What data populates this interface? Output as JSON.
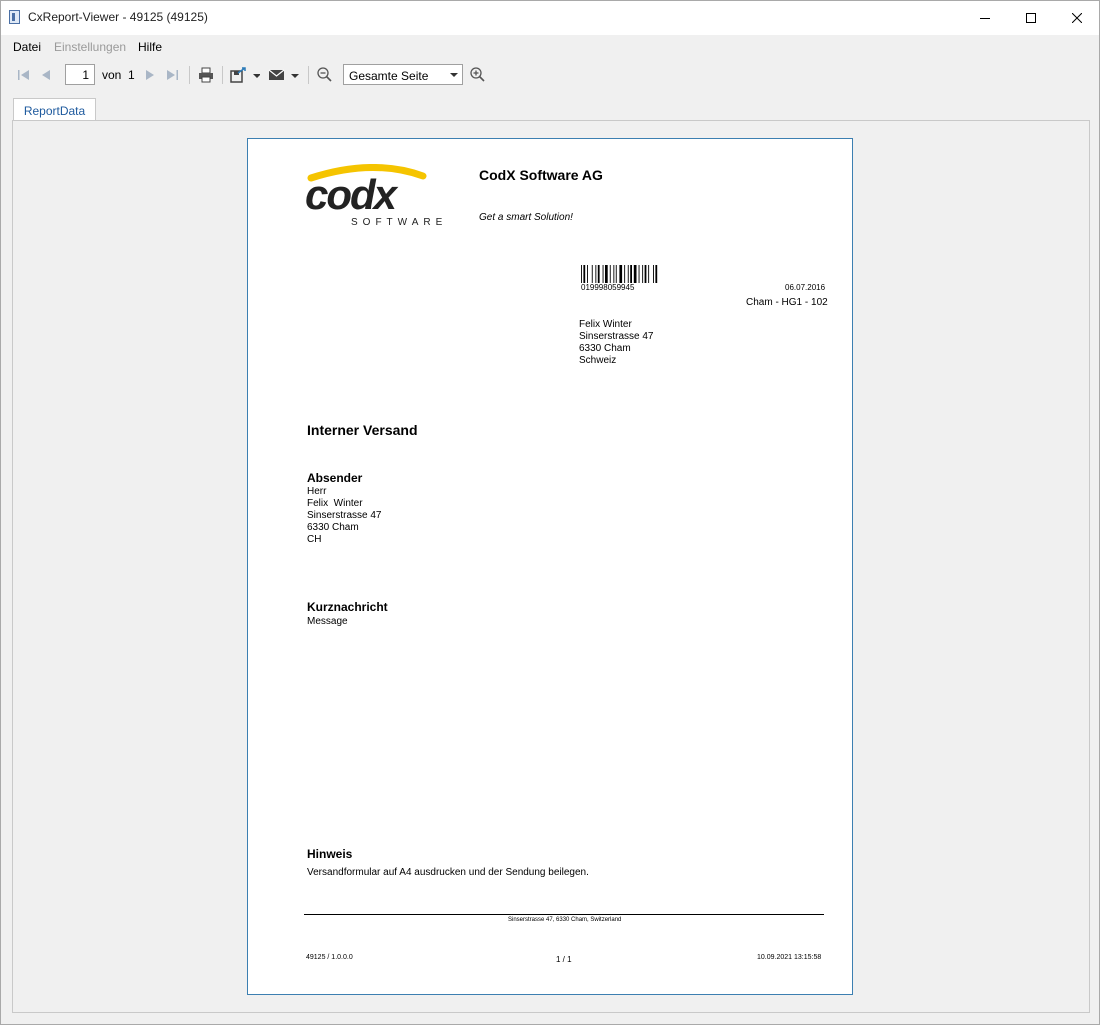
{
  "window": {
    "title": "CxReport-Viewer - 49125 (49125)"
  },
  "menu": {
    "items": [
      "Datei",
      "Einstellungen",
      "Hilfe"
    ]
  },
  "toolbar": {
    "page_current": "1",
    "of_label": "von",
    "page_total": "1",
    "zoom_value": "Gesamte Seite"
  },
  "tabs": [
    {
      "label": "ReportData"
    }
  ],
  "report": {
    "logo_word": "codx",
    "logo_sub": "SOFTWARE",
    "company": "CodX Software AG",
    "slogan": "Get a smart Solution!",
    "barcode_number": "019998059945",
    "date": "06.07.2016",
    "location": "Cham - HG1 - 102",
    "recipient": [
      "Felix Winter",
      "Sinserstrasse 47",
      "6330 Cham",
      "Schweiz"
    ],
    "heading": "Interner Versand",
    "sender_heading": "Absender",
    "sender_lines": [
      "Herr",
      "Felix  Winter",
      "Sinserstrasse 47",
      "6330 Cham",
      "CH"
    ],
    "message_heading": "Kurznachricht",
    "message_text": "Message",
    "note_heading": "Hinweis",
    "note_text": "Versandformular auf A4 ausdrucken und der Sendung beilegen.",
    "footer_address": "Sinserstrasse 47, 6330 Cham, Switzerland",
    "footer_left": "49125 / 1.0.0.0",
    "footer_center": "1 / 1",
    "footer_right": "10.09.2021 13:15:58"
  },
  "colors": {
    "accent": "#1e5a9e",
    "page_border": "#3c7fb1",
    "logo_swoosh": "#f5c400"
  }
}
